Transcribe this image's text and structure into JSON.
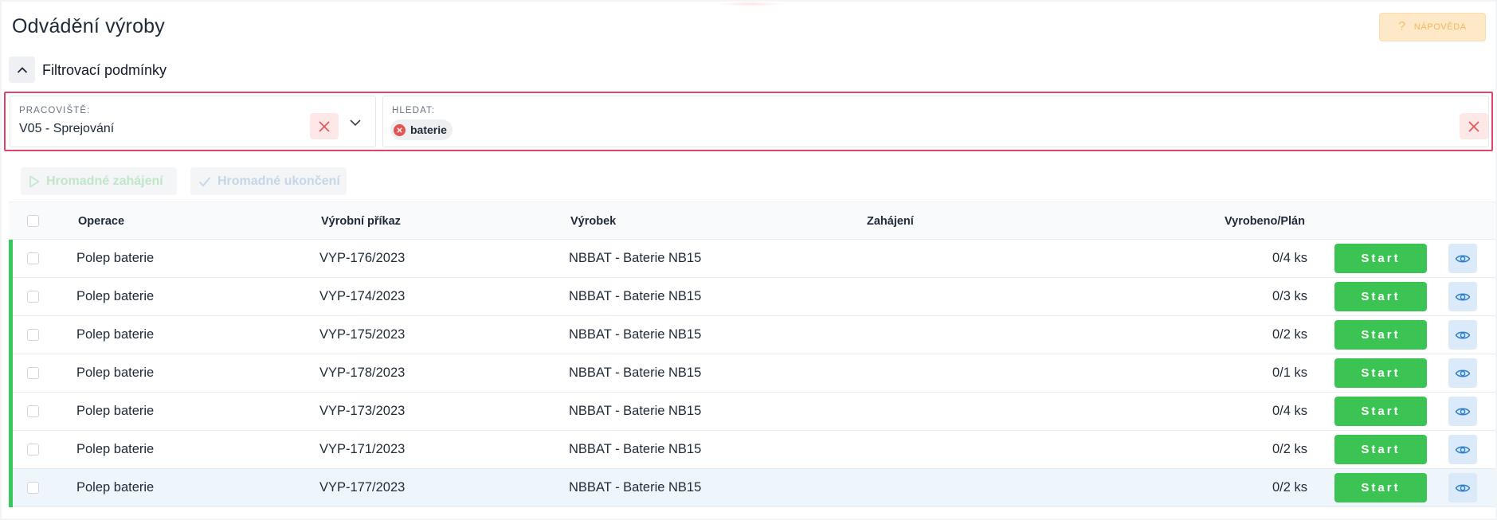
{
  "page": {
    "title": "Odvádění výroby"
  },
  "help": {
    "label": "NÁPOVĚDA",
    "icon": "question-icon"
  },
  "filters": {
    "section_title": "Filtrovací podmínky",
    "workplace": {
      "label": "PRACOVIŠTĚ:",
      "value": "V05 - Sprejování"
    },
    "search": {
      "label": "HLEDAT:",
      "chips": [
        "baterie"
      ]
    }
  },
  "bulk_actions": {
    "start_label": "Hromadné zahájení",
    "finish_label": "Hromadné ukončení"
  },
  "table": {
    "columns": [
      "Operace",
      "Výrobní příkaz",
      "Výrobek",
      "Zahájení",
      "Vyrobeno/Plán"
    ],
    "start_label": "Start",
    "rows": [
      {
        "operation": "Polep baterie",
        "order": "VYP-176/2023",
        "product": "NBBAT - Baterie NB15",
        "started": "",
        "produced": "0/4 ks"
      },
      {
        "operation": "Polep baterie",
        "order": "VYP-174/2023",
        "product": "NBBAT - Baterie NB15",
        "started": "",
        "produced": "0/3 ks"
      },
      {
        "operation": "Polep baterie",
        "order": "VYP-175/2023",
        "product": "NBBAT - Baterie NB15",
        "started": "",
        "produced": "0/2 ks"
      },
      {
        "operation": "Polep baterie",
        "order": "VYP-178/2023",
        "product": "NBBAT - Baterie NB15",
        "started": "",
        "produced": "0/1 ks"
      },
      {
        "operation": "Polep baterie",
        "order": "VYP-173/2023",
        "product": "NBBAT - Baterie NB15",
        "started": "",
        "produced": "0/4 ks"
      },
      {
        "operation": "Polep baterie",
        "order": "VYP-171/2023",
        "product": "NBBAT - Baterie NB15",
        "started": "",
        "produced": "0/2 ks"
      },
      {
        "operation": "Polep baterie",
        "order": "VYP-177/2023",
        "product": "NBBAT - Baterie NB15",
        "started": "",
        "produced": "0/2 ks"
      }
    ]
  },
  "colors": {
    "accent_green": "#3bc453",
    "status_bar": "#38c75a",
    "filter_border": "#e2436b",
    "help_bg": "#fde9c8",
    "eye_bg": "#dbeaf8"
  }
}
